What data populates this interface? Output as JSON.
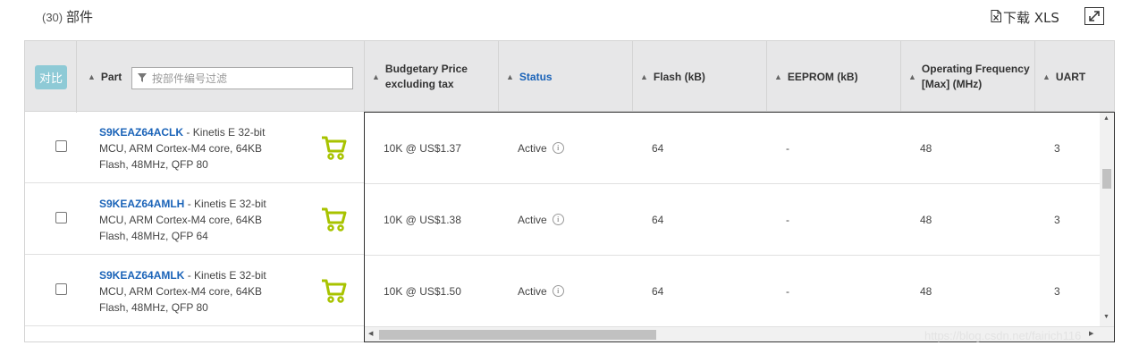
{
  "header": {
    "count": "(30)",
    "title": "部件",
    "download_label": "下载 XLS"
  },
  "table": {
    "compare_button": "对比",
    "filter_placeholder": "按部件编号过滤",
    "columns": {
      "part": "Part",
      "price": "Budgetary Price excluding tax",
      "status": "Status",
      "flash": "Flash (kB)",
      "eeprom": "EEPROM (kB)",
      "freq": "Operating Frequency [Max] (MHz)",
      "uart": "UART"
    },
    "rows": [
      {
        "part": "S9KEAZ64ACLK",
        "desc": " - Kinetis E 32-bit MCU, ARM Cortex-M4 core, 64KB Flash, 48MHz, QFP 80",
        "price": "10K @ US$1.37",
        "status": "Active",
        "flash": "64",
        "eeprom": "-",
        "freq": "48",
        "uart": "3"
      },
      {
        "part": "S9KEAZ64AMLH",
        "desc": " - Kinetis E 32-bit MCU, ARM Cortex-M4 core, 64KB Flash, 48MHz, QFP 64",
        "price": "10K @ US$1.38",
        "status": "Active",
        "flash": "64",
        "eeprom": "-",
        "freq": "48",
        "uart": "3"
      },
      {
        "part": "S9KEAZ64AMLK",
        "desc": " - Kinetis E 32-bit MCU, ARM Cortex-M4 core, 64KB Flash, 48MHz, QFP 80",
        "price": "10K @ US$1.50",
        "status": "Active",
        "flash": "64",
        "eeprom": "-",
        "freq": "48",
        "uart": "3"
      }
    ]
  },
  "watermark": "https://blog.csdn.net/fairich116",
  "colors": {
    "link": "#1a63b8",
    "cart": "#a8c300",
    "compare_button": "#8ecad6",
    "header_bg": "#e7e7e8"
  },
  "icons": {
    "download": "file-excel-icon",
    "expand": "expand-icon",
    "filter": "filter-icon",
    "cart": "cart-icon",
    "info": "info-icon"
  }
}
